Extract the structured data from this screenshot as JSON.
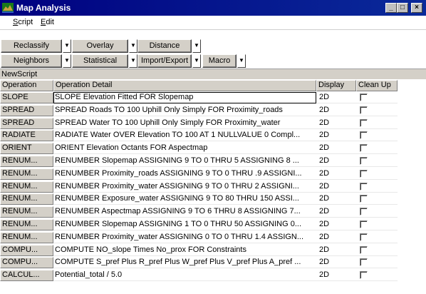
{
  "window": {
    "title": "Map Analysis",
    "minimize": "_",
    "maximize": "□",
    "close": "×"
  },
  "menu": [
    {
      "label_accel": "S",
      "label_rest": "cript"
    },
    {
      "label_accel": "E",
      "label_rest": "dit"
    }
  ],
  "toolbar": {
    "row1": [
      {
        "label": "Reclassify"
      },
      {
        "label": "Overlay"
      },
      {
        "label": "Distance"
      }
    ],
    "row2": [
      {
        "label": "Neighbors"
      },
      {
        "label": "Statistical"
      },
      {
        "label": "Import/Export"
      },
      {
        "label": "Macro"
      }
    ],
    "dropdown_glyph": "▼"
  },
  "script_name": "NewScript",
  "grid": {
    "headers": {
      "operation": "Operation",
      "detail": "Operation Detail",
      "display": "Display",
      "cleanup": "Clean Up"
    },
    "rows": [
      {
        "op": "SLOPE",
        "detail": "SLOPE Elevation Fitted FOR Slopemap",
        "display": "2D",
        "cleanup": false
      },
      {
        "op": "SPREAD",
        "detail": "SPREAD Roads TO 100 Uphill Only Simply FOR Proximity_roads",
        "display": "2D",
        "cleanup": false
      },
      {
        "op": "SPREAD",
        "detail": "SPREAD Water TO 100 Uphill Only Simply FOR Proximity_water",
        "display": "2D",
        "cleanup": false
      },
      {
        "op": "RADIATE",
        "detail": "RADIATE Water OVER Elevation TO 100 AT 1 NULLVALUE 0 Compl...",
        "display": "2D",
        "cleanup": false
      },
      {
        "op": "ORIENT",
        "detail": "ORIENT Elevation Octants FOR Aspectmap",
        "display": "2D",
        "cleanup": false
      },
      {
        "op": "RENUM...",
        "detail": "RENUMBER Slopemap ASSIGNING 9 TO 0 THRU 5 ASSIGNING 8 ...",
        "display": "2D",
        "cleanup": false
      },
      {
        "op": "RENUM...",
        "detail": "RENUMBER Proximity_roads ASSIGNING 9 TO 0 THRU .9 ASSIGNI...",
        "display": "2D",
        "cleanup": false
      },
      {
        "op": "RENUM...",
        "detail": "RENUMBER Proximity_water ASSIGNING 9 TO 0 THRU 2 ASSIGNI...",
        "display": "2D",
        "cleanup": false
      },
      {
        "op": "RENUM...",
        "detail": "RENUMBER Exposure_water ASSIGNING 9 TO 80 THRU 150 ASSI...",
        "display": "2D",
        "cleanup": false
      },
      {
        "op": "RENUM...",
        "detail": "RENUMBER Aspectmap ASSIGNING 9 TO 6 THRU 8 ASSIGNING 7...",
        "display": "2D",
        "cleanup": false
      },
      {
        "op": "RENUM...",
        "detail": "RENUMBER Slopemap ASSIGNING 1 TO 0 THRU 50 ASSIGNING 0...",
        "display": "2D",
        "cleanup": false
      },
      {
        "op": "RENUM...",
        "detail": "RENUMBER Proximity_water ASSIGNING 0 TO 0 THRU 1.4 ASSIGN...",
        "display": "2D",
        "cleanup": false
      },
      {
        "op": "COMPU...",
        "detail": "COMPUTE NO_slope Times No_prox FOR Constraints",
        "display": "2D",
        "cleanup": false
      },
      {
        "op": "COMPU...",
        "detail": "COMPUTE S_pref Plus R_pref Plus W_pref Plus V_pref Plus A_pref ...",
        "display": "2D",
        "cleanup": false
      },
      {
        "op": "CALCUL...",
        "detail": "Potential_total  /  5.0",
        "display": "2D",
        "cleanup": false
      }
    ]
  },
  "colors": {
    "titlebar": "#000080",
    "face": "#d4d0c8"
  }
}
